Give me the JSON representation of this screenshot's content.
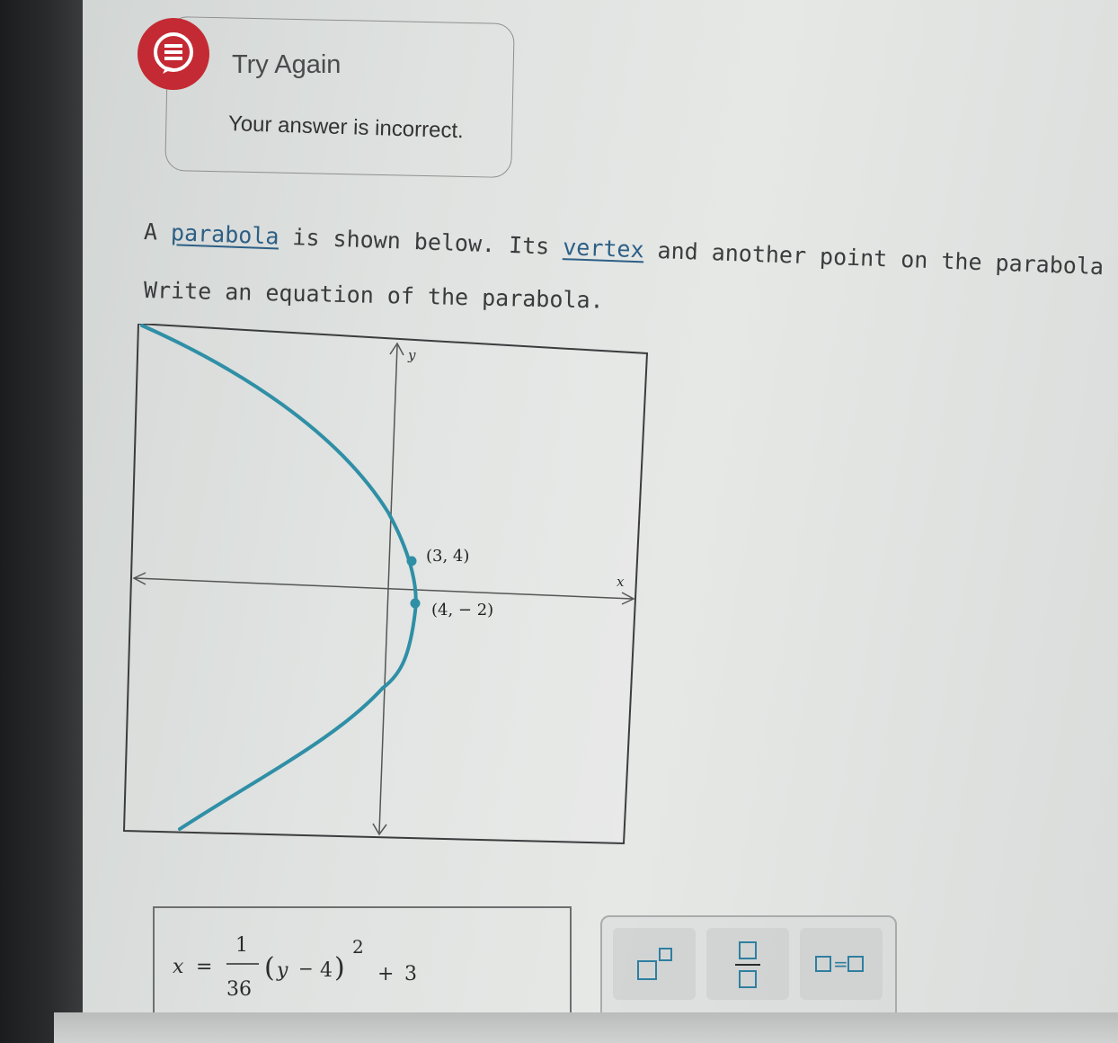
{
  "feedback": {
    "title": "Try Again",
    "message": "Your answer is incorrect.",
    "icon": "speech-bubble-icon",
    "accent_color": "#c42a33"
  },
  "question": {
    "line1_prefix": "A ",
    "link_parabola": "parabola",
    "line1_mid": " is shown below. Its ",
    "link_vertex": "vertex",
    "line1_suffix": " and another point on the parabola are labeled",
    "line2": "Write an equation of the parabola."
  },
  "graph": {
    "y_axis_label": "y",
    "x_axis_label": "x",
    "point_a_label": "(3, 4)",
    "point_b_label": "(4, − 2)",
    "curve_color": "#2f8fa6"
  },
  "answer": {
    "lhs": "x",
    "eq": "=",
    "num": "1",
    "den": "36",
    "paren_open": "(",
    "y": "y",
    "minus": "−",
    "four": "4",
    "paren_close": ")",
    "exp": "2",
    "plus": "+",
    "three": "3"
  },
  "keypad": {
    "keys": [
      "superscript-key",
      "fraction-key",
      "equals-key"
    ],
    "equals_glyph": "="
  }
}
